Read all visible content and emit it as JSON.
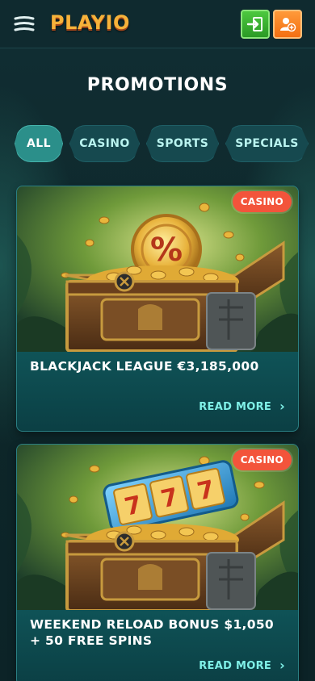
{
  "header": {
    "logo_text": "PLAYIO"
  },
  "page": {
    "title": "PROMOTIONS"
  },
  "tabs": [
    {
      "label": "ALL",
      "active": true
    },
    {
      "label": "CASINO",
      "active": false
    },
    {
      "label": "SPORTS",
      "active": false
    },
    {
      "label": "SPECIALS",
      "active": false
    }
  ],
  "promotions": [
    {
      "badge": "CASINO",
      "title": "BLACKJACK LEAGUE €3,185,000",
      "read_more": "READ MORE",
      "image": "treasure-chest-percent-coin"
    },
    {
      "badge": "CASINO",
      "title": "WEEKEND RELOAD BONUS $1,050 + 50 FREE SPINS",
      "read_more": "READ MORE",
      "image": "treasure-chest-slot-reel"
    }
  ],
  "colors": {
    "background": "#0f2a2f",
    "accent": "#2b8f8a",
    "badge": "#f3543b",
    "read_more": "#7ff0e7",
    "login_button": "#3bb432",
    "register_button": "#f7821f"
  }
}
